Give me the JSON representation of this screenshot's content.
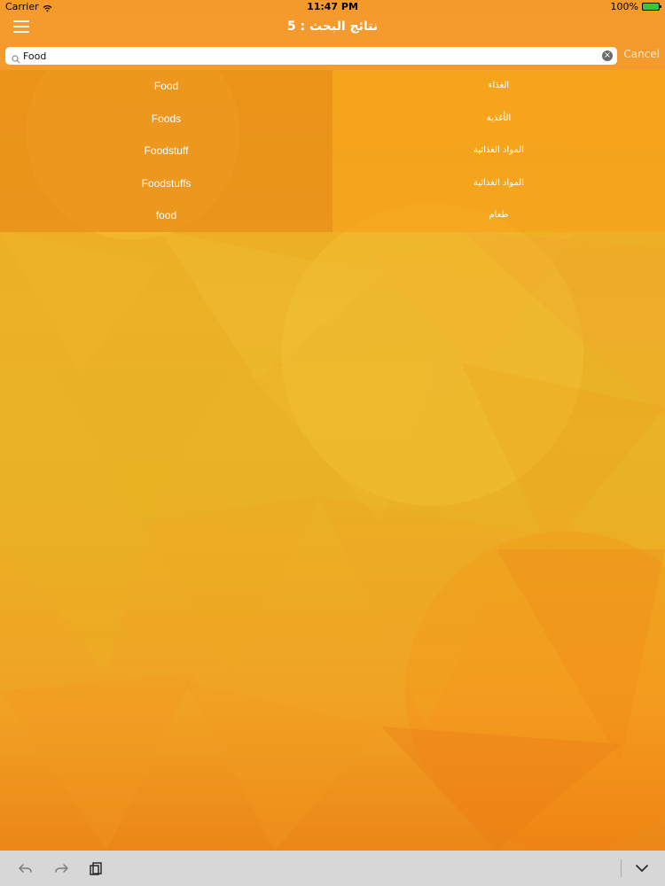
{
  "status_bar": {
    "carrier": "Carrier",
    "time": "11:47 PM",
    "battery": "100%"
  },
  "nav": {
    "title": "نتائج البحث : 5"
  },
  "search": {
    "value": "Food",
    "placeholder": "",
    "cancel_label": "Cancel"
  },
  "results": [
    {
      "english": "Food",
      "arabic": "الغذاء"
    },
    {
      "english": "Foods",
      "arabic": "الأغذية"
    },
    {
      "english": "Foodstuff",
      "arabic": "المواد الغذائية"
    },
    {
      "english": "Foodstuffs",
      "arabic": "المواد الغذائية"
    },
    {
      "english": "food",
      "arabic": "طعام"
    }
  ],
  "icons": {
    "menu": "menu-icon",
    "search": "search-icon",
    "clear": "clear-search-icon",
    "undo": "undo-icon",
    "redo": "redo-icon",
    "paste": "paste-icon",
    "chevron_down": "chevron-down-icon",
    "wifi": "wifi-icon",
    "battery": "battery-icon"
  },
  "colors": {
    "nav": "#f59a2d",
    "left_column": "#e78014",
    "right_column": "#f7a01a",
    "bottom_bar": "#d7d7d7",
    "battery_fill": "#39c449"
  }
}
